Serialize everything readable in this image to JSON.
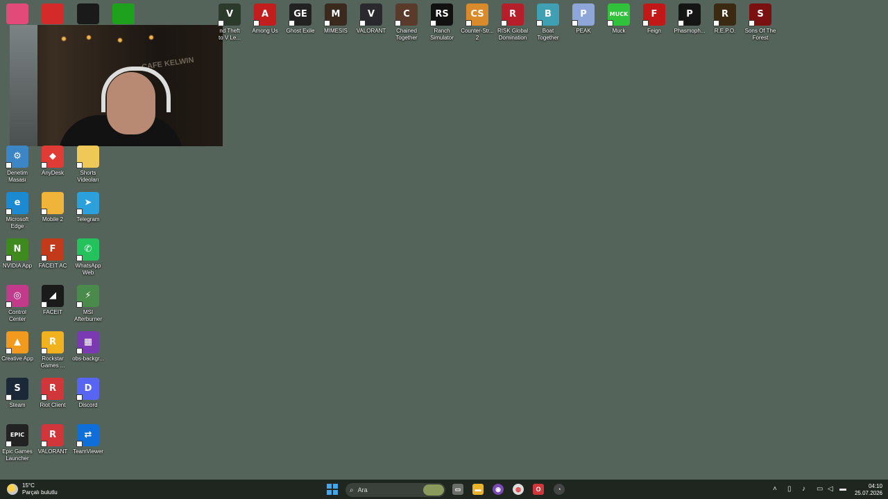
{
  "desktop": {
    "top_icons": [
      {
        "label": "nd Theft\nto V Le...",
        "glyph": "V",
        "color": "#2b3a2a",
        "icon": "gta-icon"
      },
      {
        "label": "Among Us",
        "glyph": "A",
        "color": "#c21e1e",
        "icon": "among-us-icon"
      },
      {
        "label": "Ghost Exile",
        "glyph": "GE",
        "color": "#222222",
        "icon": "ghost-exile-icon"
      },
      {
        "label": "MIMESIS",
        "glyph": "M",
        "color": "#3a2a1e",
        "icon": "mimesis-icon"
      },
      {
        "label": "VALORANT",
        "glyph": "V",
        "color": "#2a2a2e",
        "icon": "valorant-icon"
      },
      {
        "label": "Chained\nTogether",
        "glyph": "C",
        "color": "#5a3a2a",
        "icon": "chained-together-icon"
      },
      {
        "label": "Ranch\nSimulator",
        "glyph": "RS",
        "color": "#111111",
        "icon": "ranch-simulator-icon"
      },
      {
        "label": "Counter-Str...\n2",
        "glyph": "CS",
        "color": "#d98a2a",
        "icon": "counter-strike-icon"
      },
      {
        "label": "RISK Global\nDomination",
        "glyph": "R",
        "color": "#b61e2a",
        "icon": "risk-icon"
      },
      {
        "label": "Boat\nTogether",
        "glyph": "B",
        "color": "#3fa0b4",
        "icon": "boat-together-icon"
      },
      {
        "label": "PEAK",
        "glyph": "P",
        "color": "#8fa6d8",
        "icon": "peak-icon"
      },
      {
        "label": "Muck",
        "glyph": "MUCK",
        "color": "#2fc23a",
        "icon": "muck-icon"
      },
      {
        "label": "Feign",
        "glyph": "F",
        "color": "#c21818",
        "icon": "feign-icon"
      },
      {
        "label": "Phasmoph...",
        "glyph": "P",
        "color": "#151515",
        "icon": "phasmophobia-icon"
      },
      {
        "label": "R.E.P.O.",
        "glyph": "R",
        "color": "#3a2a12",
        "icon": "repo-icon"
      },
      {
        "label": "Sons Of The\nForest",
        "glyph": "S",
        "color": "#7a1010",
        "icon": "sons-of-the-forest-icon"
      }
    ],
    "left_icons": [
      {
        "label": "Denetim\nMasası",
        "glyph": "⚙",
        "color": "#3d86c6",
        "icon": "control-panel-icon"
      },
      {
        "label": "AnyDesk",
        "glyph": "◆",
        "color": "#e03b34",
        "icon": "anydesk-icon"
      },
      {
        "label": "Shorts\nVideoları",
        "glyph": "",
        "color": "#f0c858",
        "icon": "folder-icon"
      },
      {
        "label": "Microsoft\nEdge",
        "glyph": "e",
        "color": "#1b8ad0",
        "icon": "edge-icon"
      },
      {
        "label": "Mobile 2",
        "glyph": "",
        "color": "#f0b43a",
        "icon": "folder-icon"
      },
      {
        "label": "Telegram",
        "glyph": "➤",
        "color": "#2aa1dd",
        "icon": "telegram-icon"
      },
      {
        "label": "NVIDIA App",
        "glyph": "N",
        "color": "#3e8a1e",
        "icon": "nvidia-icon"
      },
      {
        "label": "FACEIT AC",
        "glyph": "F",
        "color": "#c23a1a",
        "icon": "faceit-ac-icon"
      },
      {
        "label": "WhatsApp\nWeb",
        "glyph": "✆",
        "color": "#25c15c",
        "icon": "whatsapp-icon"
      },
      {
        "label": "Control\nCenter",
        "glyph": "◎",
        "color": "#c23a8a",
        "icon": "control-center-icon"
      },
      {
        "label": "FACEIT",
        "glyph": "◢",
        "color": "#1a1a1a",
        "icon": "faceit-icon"
      },
      {
        "label": "MSI\nAfterburner",
        "glyph": "⚡",
        "color": "#4a8a4a",
        "icon": "msi-afterburner-icon"
      },
      {
        "label": "Creative App",
        "glyph": "▲",
        "color": "#f29a1e",
        "icon": "creative-app-icon"
      },
      {
        "label": "Rockstar\nGames ...",
        "glyph": "R",
        "color": "#f2b21e",
        "icon": "rockstar-icon"
      },
      {
        "label": "obs-backgr...",
        "glyph": "▦",
        "color": "#7a3ab4",
        "icon": "winrar-icon"
      },
      {
        "label": "Steam",
        "glyph": "S",
        "color": "#1b2838",
        "icon": "steam-icon"
      },
      {
        "label": "Riot Client",
        "glyph": "R",
        "color": "#d1363a",
        "icon": "riot-client-icon"
      },
      {
        "label": "Discord",
        "glyph": "D",
        "color": "#5865f2",
        "icon": "discord-icon"
      },
      {
        "label": "Epic Games\nLauncher",
        "glyph": "EPIC",
        "color": "#222222",
        "icon": "epic-games-icon"
      },
      {
        "label": "VALORANT",
        "glyph": "R",
        "color": "#d1363a",
        "icon": "valorant-riot-icon"
      },
      {
        "label": "TeamViewer",
        "glyph": "⇄",
        "color": "#0e6fd8",
        "icon": "teamviewer-icon"
      }
    ],
    "corner_icons": [
      {
        "label": "",
        "color": "#e24a7a",
        "icon": "itunes-icon"
      },
      {
        "label": "",
        "color": "#d52a2a",
        "icon": "folder-red-icon"
      },
      {
        "label": "",
        "color": "#1a1a1a",
        "icon": "capcut-icon"
      },
      {
        "label": "",
        "color": "#1ea21e",
        "icon": "chart-app-icon"
      }
    ],
    "webcam_sign": "CAFE KELWIN"
  },
  "taskbar": {
    "weather_temp": "15°C",
    "weather_desc": "Parçalı bulutlu",
    "search_placeholder": "Ara",
    "time": "04:10",
    "date": "25.07.2026"
  }
}
